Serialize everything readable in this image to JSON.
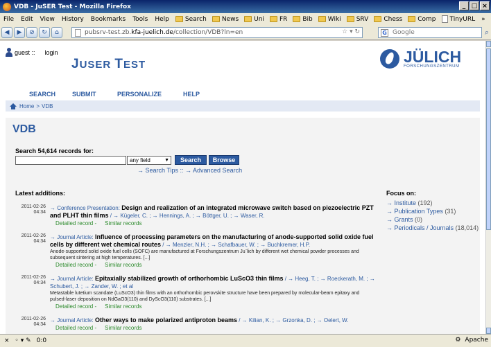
{
  "window": {
    "title": "VDB - JuSER Test - Mozilla Firefox"
  },
  "menu": {
    "items": [
      "File",
      "Edit",
      "View",
      "History",
      "Bookmarks",
      "Tools",
      "Help"
    ],
    "bookmarks": [
      "Search",
      "News",
      "Uni",
      "FR",
      "Bib",
      "Wiki",
      "SRV",
      "Chess",
      "Comp",
      "TinyURL"
    ],
    "more": "»"
  },
  "nav": {
    "url_prefix": "pubsrv-test.zb.",
    "url_domain": "kfa-juelich.de",
    "url_path": "/collection/VDB?ln=en",
    "search_placeholder": "Google"
  },
  "header": {
    "user": "guest ::",
    "login": "login",
    "site_title_j": "J",
    "site_title_rest": "USER ",
    "site_title_t": "T",
    "site_title_est": "EST",
    "logo_text": "JÜLICH",
    "logo_sub": "FORSCHUNGSZENTRUM"
  },
  "topnav": [
    "SEARCH",
    "SUBMIT",
    "PERSONALIZE",
    "HELP"
  ],
  "breadcrumb": {
    "home": "Home",
    "sep": ">",
    "current": "VDB"
  },
  "main": {
    "title": "VDB",
    "search_label": "Search 54,614 records for:",
    "field_select": "any field",
    "search_button": "Search",
    "browse_button": "Browse",
    "tips": "→ Search Tips :: → Advanced Search",
    "latest_heading": "Latest additions:"
  },
  "records": [
    {
      "date": "2011-02-26",
      "time": "04:34",
      "kind": "→ Conference Presentation:",
      "title": "Design and realization of an integrated microwave switch based on piezoelectric PZT and PLHT thin films",
      "authors": "/ → Kügeler, C. ; → Hennings, A. ; → Böttger, U. ; → Waser, R.",
      "abstract": "",
      "detailed": "Detailed record -",
      "similar": "Similar records"
    },
    {
      "date": "2011-02-26",
      "time": "04:34",
      "kind": "→ Journal Article:",
      "title": "Influence of processing parameters on the manufacturing of anode-supported solid oxide fuel cells by different wet chemical routes",
      "authors": "/ → Menzler, N.H. ; → Schafbauer, W. ; → Buchkremer, H.P.",
      "abstract": "Anode-supported solid oxide fuel cells (SOFC) are manufactured at Forschungszentrum Ju¨lich by different wet chemical powder processes and subsequent sintering at high temperatures. [...]",
      "detailed": "Detailed record -",
      "similar": "Similar records"
    },
    {
      "date": "2011-02-26",
      "time": "04:34",
      "kind": "→ Journal Article:",
      "title": "Epitaxially stabilized growth of orthorhombic LuScO3 thin films",
      "authors": "/ → Heeg, T. ; → Roeckerath, M. ; → Schubert, J. ; → Zander, W. ; et al",
      "abstract": "Metastable lutetium scandate (LuScO3) thin films with an orthorhombic perovskite structure have been prepared by molecular-beam epitaxy and pulsed-laser deposition on NdGaO3(110) and DyScO3(110) substrates. [...]",
      "detailed": "Detailed record -",
      "similar": "Similar records"
    },
    {
      "date": "2011-02-26",
      "time": "04:34",
      "kind": "→ Journal Article:",
      "title": "Other ways to make polarized antiproton beams",
      "authors": "/ → Kilian, K. ; → Grzonka, D. ; → Oelert, W.",
      "abstract": "",
      "detailed": "Detailed record -",
      "similar": "Similar records"
    }
  ],
  "focus": {
    "heading": "Focus on:",
    "items": [
      {
        "label": "→ Institute",
        "count": "(192)"
      },
      {
        "label": "→ Publication Types",
        "count": "(31)"
      },
      {
        "label": "→ Grants",
        "count": "(0)"
      },
      {
        "label": "→ Periodicals / Journals",
        "count": "(18,014)"
      }
    ]
  },
  "status": {
    "left": "0:0",
    "right": "Apache"
  },
  "colors": {
    "accent": "#2c5aa0",
    "link_green": "#2b8a2b"
  }
}
